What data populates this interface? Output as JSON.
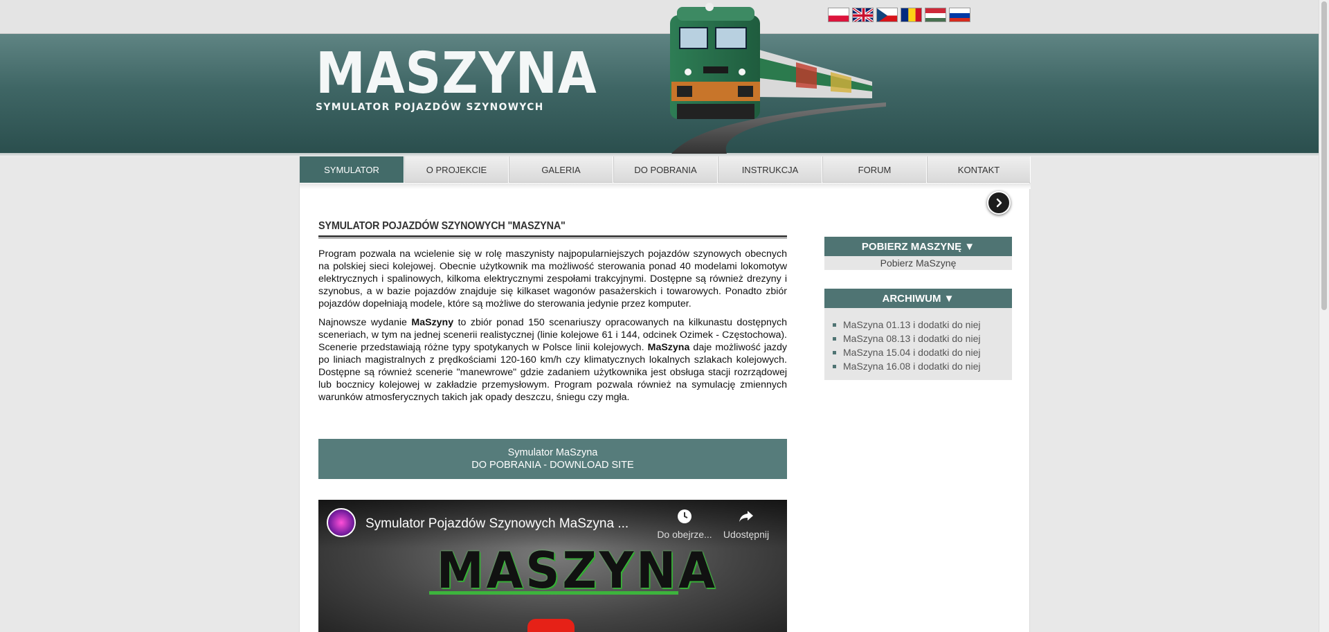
{
  "header": {
    "logo_main": "MASZYNA",
    "logo_sub": "SYMULATOR POJAZDÓW SZYNOWYCH",
    "flags": [
      "Polski",
      "English",
      "Čeština",
      "Română",
      "Magyar",
      "Русский"
    ]
  },
  "nav": {
    "items": [
      {
        "label": "SYMULATOR"
      },
      {
        "label": "O PROJEKCIE"
      },
      {
        "label": "GALERIA"
      },
      {
        "label": "DO POBRANIA"
      },
      {
        "label": "INSTRUKCJA"
      },
      {
        "label": "FORUM"
      },
      {
        "label": "KONTAKT"
      }
    ]
  },
  "main": {
    "title": "SYMULATOR POJAZDÓW SZYNOWYCH \"MASZYNA\"",
    "para1": "Program pozwala na wcielenie się w rolę maszynisty najpopularniejszych pojazdów szynowych obecnych na polskiej sieci kolejowej. Obecnie użytkownik ma możliwość sterowania ponad 40 modelami lokomotyw elektrycznych i spalinowych, kilkoma elektrycznymi zespołami trakcyjnymi. Dostępne są również drezyny i szynobus, a w bazie pojazdów znajduje się kilkaset wagonów pasażerskich i towarowych. Ponadto zbiór pojazdów dopełniają modele, które są możliwe do sterowania jedynie przez komputer.",
    "para2": {
      "t1": "Najnowsze wydanie ",
      "b1": "MaSzyny",
      "t2": " to zbiór ponad 150 scenariuszy opracowanych na kilkunastu dostępnych sceneriach, w tym na jednej scenerii realistycznej (linie kolejowe 61 i 144, odcinek Ozimek - Częstochowa). Scenerie przedstawiają różne typy spotykanych w Polsce linii kolejowych. ",
      "b2": "MaSzyna",
      "t3": " daje możliwość jazdy po liniach magistralnych z prędkościami 120-160 km/h czy klimatycznych lokalnych szlakach kolejowych. Dostępne są również scenerie \"manewrowe\" gdzie zadaniem użytkownika jest obsługa stacji rozrządowej lub bocznicy kolejowej w zakładzie przemysłowym. Program pozwala również na symulację zmiennych warunków atmosferycznych takich jak opady deszczu, śniegu czy mgła."
    },
    "download_line1": "Symulator MaSzyna",
    "download_line2": "DO POBRANIA - DOWNLOAD SITE",
    "video": {
      "title": "Symulator Pojazdów Szynowych MaSzyna ...",
      "watch_later": "Do obejrze...",
      "share": "Udostępnij",
      "logo": "MASZYNA"
    }
  },
  "sidebar": {
    "box1_title": "POBIERZ MASZYNĘ ▼",
    "box1_link": "Pobierz MaSzynę",
    "box2_title": "ARCHIWUM ▼",
    "archive": [
      {
        "label": "MaSzyna 01.13 i dodatki do niej"
      },
      {
        "label": "MaSzyna 08.13 i dodatki do niej"
      },
      {
        "label": "MaSzyna 15.04 i dodatki do niej"
      },
      {
        "label": "MaSzyna 16.08 i dodatki do niej"
      }
    ]
  },
  "colors": {
    "accent": "#436b69",
    "header_dark": "#2a4e4d",
    "download_bg": "#567c7b"
  }
}
